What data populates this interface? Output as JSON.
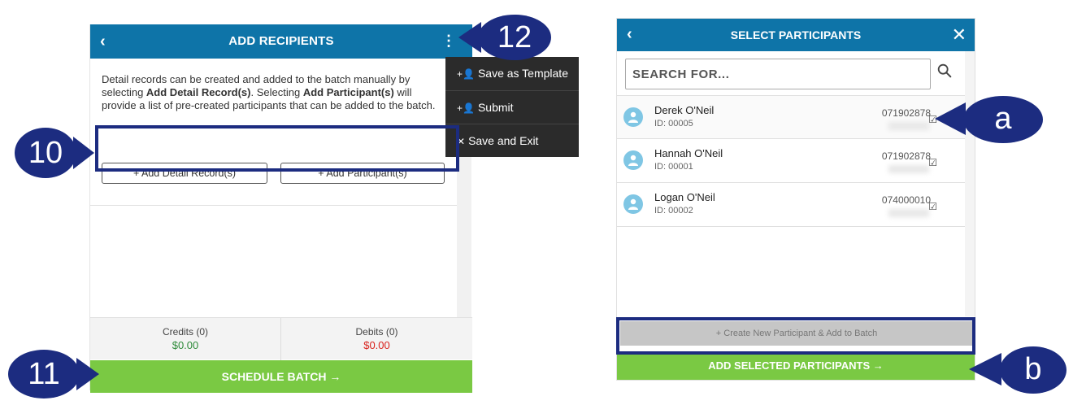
{
  "left": {
    "header": {
      "back_icon": "‹",
      "title": "ADD RECIPIENTS",
      "kebab_icon": "⋮"
    },
    "description": {
      "p1": "Detail records can be created and added to the batch manually by selecting ",
      "b1": "Add Detail Record(s)",
      "p2": ". Selecting ",
      "b2": "Add Participant(s)",
      "p3": " will provide a list of pre-created participants that can be added to the batch."
    },
    "buttons": {
      "add_detail": "+ Add Detail Record(s)",
      "add_participant": "+ Add Participant(s)"
    },
    "footer": {
      "credits_label": "Credits (0)",
      "credits_value": "$0.00",
      "debits_label": "Debits (0)",
      "debits_value": "$0.00"
    },
    "schedule_label": "SCHEDULE BATCH →"
  },
  "menu": {
    "items": [
      {
        "label": "Save as Template",
        "icon": "+👤"
      },
      {
        "label": "Submit",
        "icon": "+👤"
      },
      {
        "label": "Save and Exit",
        "icon": "✕"
      }
    ]
  },
  "callouts": {
    "c10": "10",
    "c11": "11",
    "c12": "12",
    "a": "a",
    "b": "b"
  },
  "right": {
    "header": {
      "back_icon": "‹",
      "title": "SELECT PARTICIPANTS",
      "close_icon": "✕"
    },
    "search": {
      "placeholder": "SEARCH FOR...",
      "value": ""
    },
    "participants": [
      {
        "name": "Derek O'Neil",
        "id": "ID: 00005",
        "routing": "071902878",
        "check": "☑"
      },
      {
        "name": "Hannah O'Neil",
        "id": "ID: 00001",
        "routing": "071902878",
        "check": "☑"
      },
      {
        "name": "Logan O'Neil",
        "id": "ID: 00002",
        "routing": "074000010",
        "check": "☑"
      }
    ],
    "create_label": "+ Create New Participant & Add to Batch",
    "add_selected_label": "ADD SELECTED PARTICIPANTS →"
  },
  "colors": {
    "header_blue": "#0e74a8",
    "accent_green": "#7ac943",
    "callout_navy": "#1c2c80",
    "menu_dark": "#2b2b2b"
  }
}
